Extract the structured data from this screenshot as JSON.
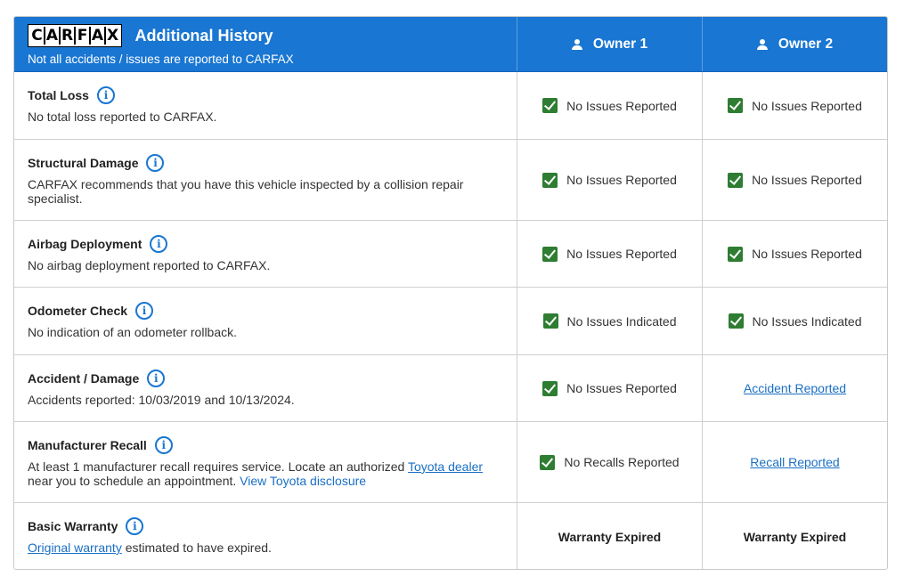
{
  "header": {
    "logo_letters": [
      "C",
      "A",
      "R",
      "F",
      "A",
      "X"
    ],
    "title": "Additional History",
    "subtitle": "Not all accidents / issues are reported to CARFAX",
    "owners": [
      "Owner 1",
      "Owner 2"
    ]
  },
  "rows": [
    {
      "title": "Total Loss",
      "desc": "No total loss reported to CARFAX.",
      "owner1": "No Issues Reported",
      "owner2": "No Issues Reported"
    },
    {
      "title": "Structural Damage",
      "desc": "CARFAX recommends that you have this vehicle inspected by a collision repair specialist.",
      "owner1": "No Issues Reported",
      "owner2": "No Issues Reported"
    },
    {
      "title": "Airbag Deployment",
      "desc": "No airbag deployment reported to CARFAX.",
      "owner1": "No Issues Reported",
      "owner2": "No Issues Reported"
    },
    {
      "title": "Odometer Check",
      "desc": "No indication of an odometer rollback.",
      "owner1": "No Issues Indicated",
      "owner2": "No Issues Indicated"
    },
    {
      "title": "Accident / Damage",
      "desc": "Accidents reported: 10/03/2019 and 10/13/2024.",
      "owner1": "No Issues Reported",
      "owner2": "Accident Reported"
    },
    {
      "title": "Manufacturer Recall",
      "desc_parts": {
        "before": "At least 1 manufacturer recall requires service. Locate an authorized ",
        "link1": "Toyota dealer",
        "middle": " near you to schedule an appointment. ",
        "link2": "View Toyota disclosure"
      },
      "owner1": "No Recalls Reported",
      "owner2": "Recall Reported"
    },
    {
      "title": "Basic Warranty",
      "desc_parts": {
        "link": "Original warranty",
        "after": " estimated to have expired."
      },
      "owner1": "Warranty Expired",
      "owner2": "Warranty Expired"
    }
  ],
  "icons": {
    "info": "info-icon",
    "check": "checkbox-checked-icon",
    "owner": "person-icon"
  },
  "colors": {
    "header_bg": "#1976d2",
    "check_green": "#2e7d32",
    "link_blue": "#1a6fc4"
  }
}
